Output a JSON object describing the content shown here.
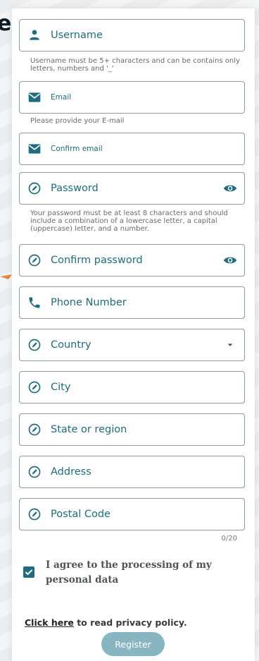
{
  "background": {
    "heading_fragment": "es"
  },
  "form": {
    "fields": [
      {
        "label": "Username",
        "icon": "person-icon",
        "hint": "Username must be 5+ characters and can be contains only letters, numbers and '_'"
      },
      {
        "label": "Email",
        "icon": "mail-icon",
        "hint": "Please provide your E-mail"
      },
      {
        "label": "Confirm email",
        "icon": "mail-icon"
      },
      {
        "label": "Password",
        "icon": "edit-circle-icon",
        "trailing_icon": "eye-icon",
        "hint": "Your password must be at least 8 characters and should include a combination of a lowercase letter, a capital (uppercase) letter, and a number."
      },
      {
        "label": "Confirm password",
        "icon": "edit-circle-icon",
        "trailing_icon": "eye-icon"
      },
      {
        "label": "Phone Number",
        "icon": "phone-icon"
      },
      {
        "label": "Country",
        "icon": "edit-circle-icon",
        "trailing_icon": "dropdown-arrow-icon"
      },
      {
        "label": "City",
        "icon": "edit-circle-icon"
      },
      {
        "label": "State or region",
        "icon": "edit-circle-icon"
      },
      {
        "label": "Address",
        "icon": "edit-circle-icon"
      },
      {
        "label": "Postal Code",
        "icon": "edit-circle-icon",
        "counter": "0/20"
      }
    ],
    "consent": {
      "label": "I agree to the processing of my personal data",
      "checked": true
    },
    "policy": {
      "link_text": "Click here",
      "suffix": " to read privacy policy."
    },
    "submit_label": "Register"
  },
  "colors": {
    "accent": "#1d6c7f",
    "button": "#87b6c2",
    "border": "#8d9aa0",
    "arrow": "#e38a3a"
  }
}
